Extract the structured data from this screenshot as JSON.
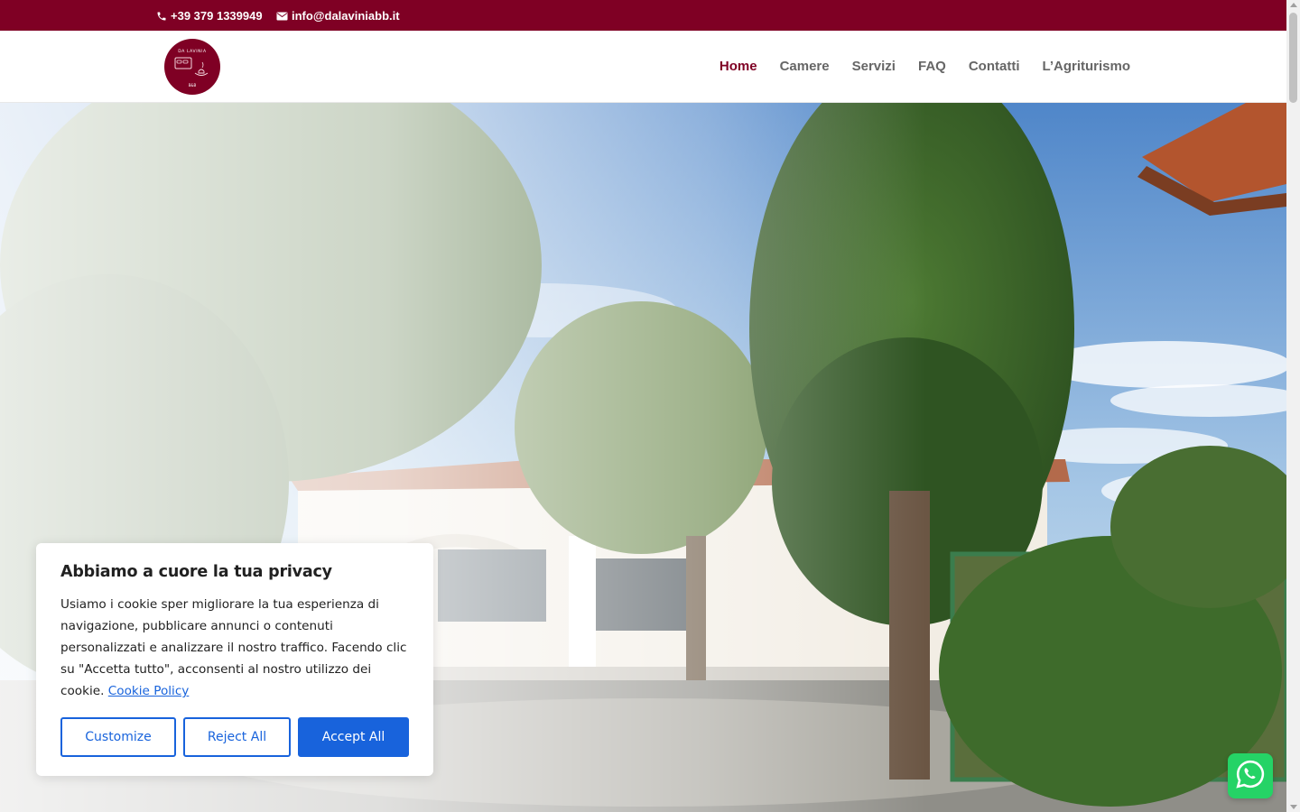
{
  "topbar": {
    "phone": "+39 379 1339949",
    "email": "info@dalaviniabb.it",
    "background": "#7f0024"
  },
  "header": {
    "logo_text_top": "DA LAVINIA",
    "logo_text_bottom": "B&B",
    "nav": [
      {
        "label": "Home",
        "active": true
      },
      {
        "label": "Camere",
        "active": false
      },
      {
        "label": "Servizi",
        "active": false
      },
      {
        "label": "FAQ",
        "active": false
      },
      {
        "label": "Contatti",
        "active": false
      },
      {
        "label": "L’Agriturismo",
        "active": false
      }
    ]
  },
  "cookie_banner": {
    "title": "Abbiamo a cuore la tua privacy",
    "body": "Usiamo i cookie sper migliorare la tua esperienza di navigazione, pubblicare annunci o contenuti personalizzati e analizzare il nostro traffico. Facendo clic su \"Accetta tutto\", acconsenti al nostro utilizzo dei cookie.",
    "policy_link": "Cookie Policy",
    "customize_label": "Customize",
    "reject_label": "Reject All",
    "accept_label": "Accept All",
    "accent": "#1863dc"
  },
  "icons": {
    "phone": "phone-icon",
    "mail": "mail-icon",
    "whatsapp": "whatsapp-icon"
  }
}
